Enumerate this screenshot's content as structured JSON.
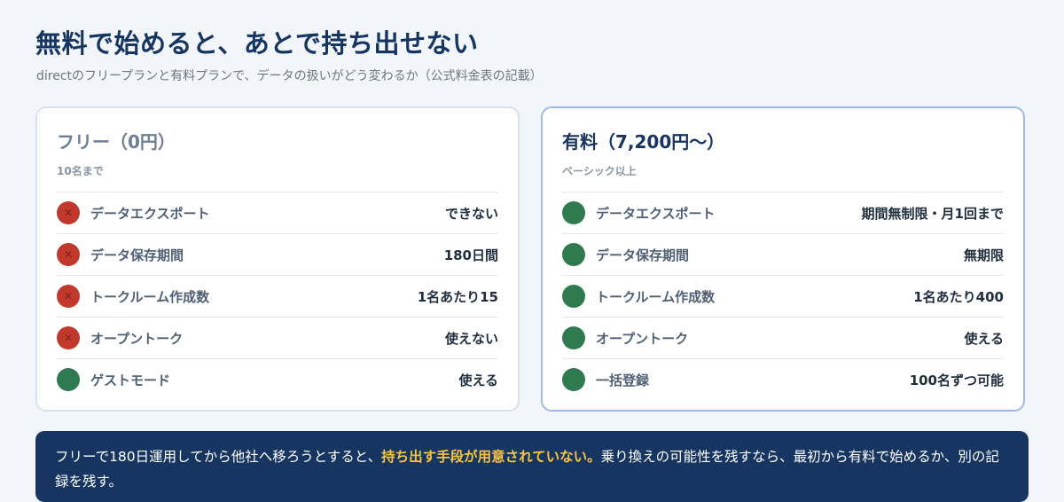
{
  "page": {
    "title": "無料で始めると、あとで持ち出せない",
    "subtitle": "directのフリープランと有料プランで、データの扱いがどう変わるか（公式料金表の記載）"
  },
  "free_plan": {
    "title": "フリー（0円）",
    "subtitle": "10名まで",
    "rows": [
      {
        "label": "データエクスポート",
        "value": "できない",
        "status": "no",
        "icon": "x-icon"
      },
      {
        "label": "データ保存期間",
        "value": "180日間",
        "status": "no",
        "icon": "x-icon"
      },
      {
        "label": "トークルーム作成数",
        "value": "1名あたり15",
        "status": "no",
        "icon": "x-icon"
      },
      {
        "label": "オープントーク",
        "value": "使えない",
        "status": "no",
        "icon": "x-icon"
      },
      {
        "label": "ゲストモード",
        "value": "使える",
        "status": "yes",
        "icon": "circle-icon"
      }
    ]
  },
  "paid_plan": {
    "title": "有料（7,200円〜）",
    "subtitle": "ベーシック以上",
    "rows": [
      {
        "label": "データエクスポート",
        "value": "期間無制限・月1回まで",
        "status": "yes",
        "icon": "circle-icon"
      },
      {
        "label": "データ保存期間",
        "value": "無期限",
        "status": "yes",
        "icon": "circle-icon"
      },
      {
        "label": "トークルーム作成数",
        "value": "1名あたり400",
        "status": "yes",
        "icon": "circle-icon"
      },
      {
        "label": "オープントーク",
        "value": "使える",
        "status": "yes",
        "icon": "circle-icon"
      },
      {
        "label": "一括登録",
        "value": "100名ずつ可能",
        "status": "yes",
        "icon": "circle-icon"
      }
    ]
  },
  "banner": {
    "text_before": "フリーで180日運用してから他社へ移ろうとすると、",
    "highlight": "持ち出す手段が用意されていない。",
    "text_after": "乗り換えの可能性を残すなら、最初から有料で始めるか、別の記録を残す。"
  },
  "colors": {
    "title": "#173561",
    "no": "#c0392b",
    "yes": "#2f7a4e",
    "banner_bg": "#173561",
    "highlight": "#f6c343"
  }
}
